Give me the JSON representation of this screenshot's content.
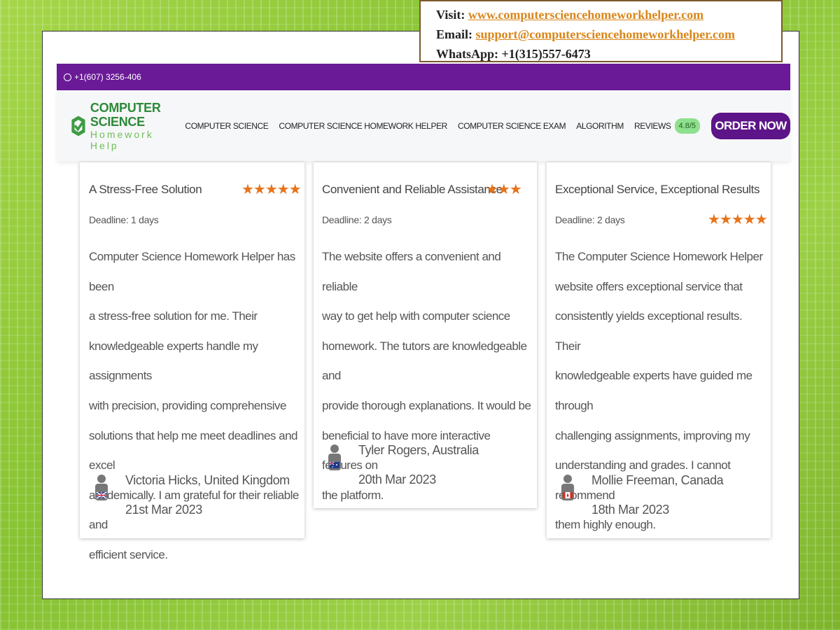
{
  "contact": {
    "visit_label": "Visit:",
    "visit_url": "www.computersciencehomeworkhelper.com",
    "email_label": "Email:",
    "email": "support@computersciencehomeworkhelper.com",
    "whatsapp": "WhatsApp: +1(315)557-6473"
  },
  "topbar": {
    "phone": "+1(607) 3256-406"
  },
  "logo": {
    "line1": "COMPUTER SCIENCE",
    "line2": "Homework Help"
  },
  "nav": {
    "items": [
      "COMPUTER SCIENCE",
      "COMPUTER SCIENCE HOMEWORK HELPER",
      "COMPUTER SCIENCE EXAM",
      "ALGORITHM",
      "REVIEWS"
    ],
    "rating": "4.8/5",
    "order_label": "ORDER NOW"
  },
  "colors": {
    "topbar": "#6a1a96",
    "order_button": "#5c1488",
    "stars": "#e8731a",
    "badge": "#8fe08e",
    "link": "#d9861a"
  },
  "reviews": [
    {
      "title": "A Stress-Free Solution",
      "stars": 5,
      "deadline": "Deadline: 1 days",
      "lines": [
        "Computer Science Homework Helper has been",
        "a stress-free solution for me. Their",
        "knowledgeable experts handle my assignments",
        "with precision, providing comprehensive",
        "solutions that help me meet deadlines and excel",
        "academically. I am grateful for their reliable and",
        "efficient service."
      ],
      "name": "Victoria Hicks, United Kingdom",
      "date": "21st Mar 2023",
      "flag": "uk-flag-icon"
    },
    {
      "title": "Convenient and Reliable Assistance",
      "stars": 3,
      "deadline": "Deadline: 2 days",
      "lines": [
        "The website offers a convenient and reliable",
        "way to get help with computer science",
        "homework. The tutors are knowledgeable and",
        "provide thorough explanations. It would be",
        "beneficial to have more interactive features on",
        "the platform."
      ],
      "name": "Tyler Rogers, Australia",
      "date": "20th Mar 2023",
      "flag": "australia-flag-icon"
    },
    {
      "title": "Exceptional Service, Exceptional Results",
      "stars": 5,
      "deadline": "Deadline: 2 days",
      "lines": [
        "The Computer Science Homework Helper",
        "website offers exceptional service that",
        "consistently yields exceptional results. Their",
        "knowledgeable experts have guided me through",
        "challenging assignments, improving my",
        "understanding and grades. I cannot recommend",
        "them highly enough."
      ],
      "name": "Mollie Freeman, Canada",
      "date": "18th Mar 2023",
      "flag": "canada-flag-icon"
    }
  ]
}
